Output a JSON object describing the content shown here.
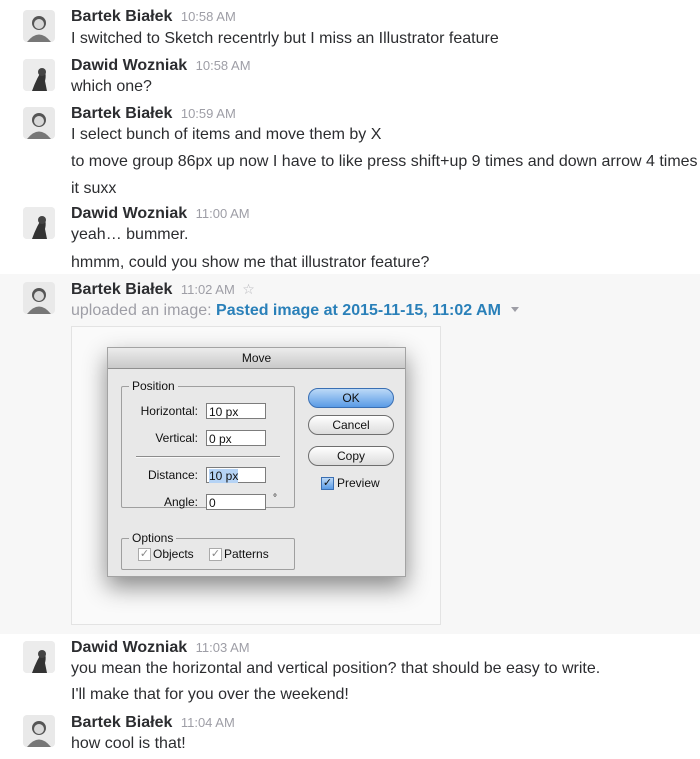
{
  "users": {
    "bartek": "Bartek Białek",
    "dawid": "Dawid Wozniak"
  },
  "messages": [
    {
      "user": "Bartek Białek",
      "time": "10:58 AM",
      "lines": [
        "I switched to Sketch recentrly but I miss an Illustrator feature"
      ]
    },
    {
      "user": "Dawid Wozniak",
      "time": "10:58 AM",
      "lines": [
        "which one?"
      ]
    },
    {
      "user": "Bartek Białek",
      "time": "10:59 AM",
      "lines": [
        "I select bunch of items and move them by X",
        "to move group 86px up now I have to like press shift+up 9 times and down arrow 4 times",
        "it suxx"
      ]
    },
    {
      "user": "Dawid Wozniak",
      "time": "11:00 AM",
      "lines": [
        "yeah… bummer.",
        "hmmm, could you show me that illustrator feature?"
      ]
    },
    {
      "user": "Bartek Białek",
      "time": "11:02 AM",
      "upload_prefix": "uploaded an image:",
      "upload_link": "Pasted image at 2015-11-15, 11:02 AM"
    },
    {
      "user": "Dawid Wozniak",
      "time": "11:03 AM",
      "lines": [
        "you mean the horizontal and vertical position? that should be easy to write.",
        "I'll make that for you over the weekend!"
      ]
    },
    {
      "user": "Bartek Białek",
      "time": "11:04 AM",
      "lines": [
        "how cool is that!"
      ]
    }
  ],
  "dialog": {
    "title": "Move",
    "position_label": "Position",
    "horizontal_label": "Horizontal:",
    "horizontal_value": "10 px",
    "vertical_label": "Vertical:",
    "vertical_value": "0 px",
    "distance_label": "Distance:",
    "distance_value": "10 px",
    "angle_label": "Angle:",
    "angle_value": "0",
    "degree_symbol": "°",
    "options_label": "Options",
    "objects_label": "Objects",
    "patterns_label": "Patterns",
    "ok_label": "OK",
    "cancel_label": "Cancel",
    "copy_label": "Copy",
    "preview_label": "Preview",
    "check_mark": "✓"
  },
  "icons": {
    "star": "☆"
  },
  "colors": {
    "link": "#2a80b9",
    "timestamp": "#9e9ea6",
    "highlight_row": "#f7f7f7"
  }
}
